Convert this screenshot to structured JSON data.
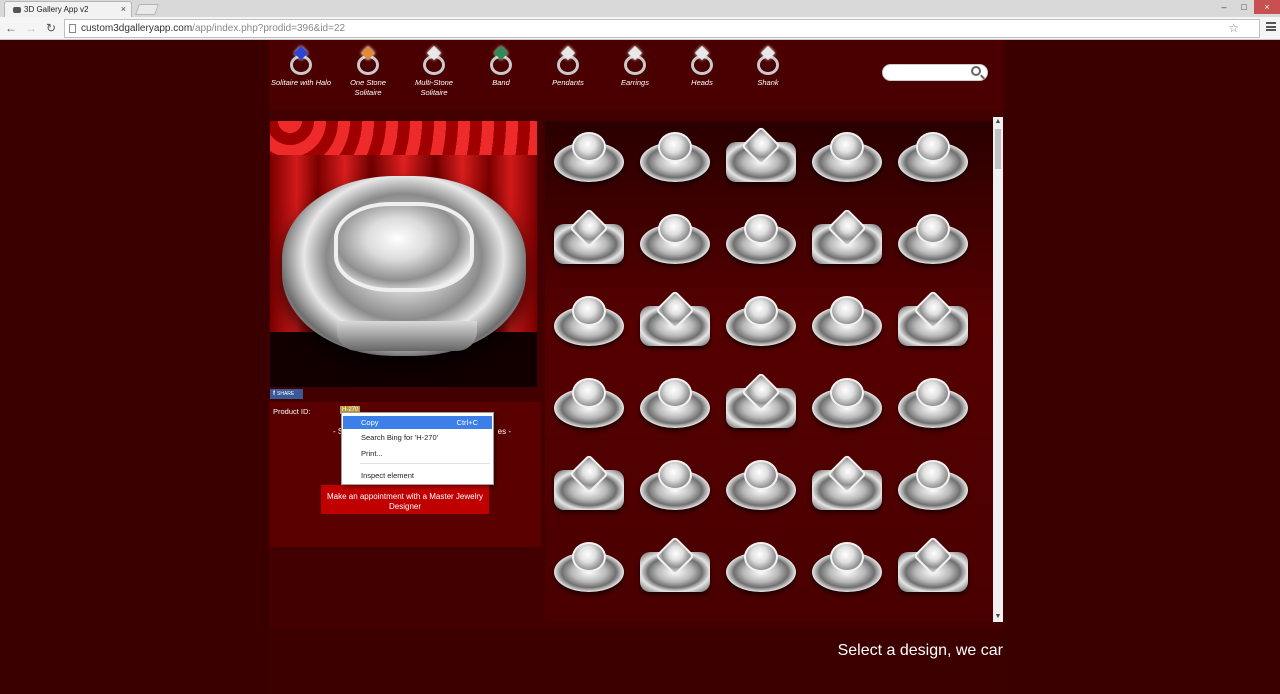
{
  "browser": {
    "tab_title": "3D Gallery App v2",
    "tab_close": "×",
    "url_host": "custom3dgalleryapp.com",
    "url_path": "/app/index.php?prodid=396&id=22",
    "window_controls": [
      "–",
      "□",
      "×"
    ],
    "nav": {
      "back": "←",
      "forward": "→",
      "reload": "↻"
    },
    "star": "☆"
  },
  "categories": [
    {
      "label": "Solitaire with Halo",
      "icon": "solitaire-halo-ring-icon",
      "gem_color": "#2a45d8"
    },
    {
      "label": "One Stone Solitaire",
      "icon": "one-stone-solitaire-ring-icon",
      "gem_color": "#e08a3c"
    },
    {
      "label": "Multi-Stone Solitaire",
      "icon": "multi-stone-ring-icon",
      "gem_color": "#e8e8e8"
    },
    {
      "label": "Band",
      "icon": "band-ring-icon",
      "gem_color": "#2e8b57"
    },
    {
      "label": "Pendants",
      "icon": "pendant-icon",
      "gem_color": "#e8e8e8"
    },
    {
      "label": "Earrings",
      "icon": "earrings-icon",
      "gem_color": "#e8e8e8"
    },
    {
      "label": "Heads",
      "icon": "head-setting-icon",
      "gem_color": "#e8e8e8"
    },
    {
      "label": "Shank",
      "icon": "shank-icon",
      "gem_color": "#e8e8e8"
    }
  ],
  "search": {
    "placeholder": ""
  },
  "preview": {
    "share_label": "SHARE",
    "share_icon": "facebook-icon"
  },
  "product": {
    "id_label": "Product ID:",
    "id_value": "H-270",
    "obscured_left": "- S",
    "obscured_right": "es -",
    "appointment_button": "Make an appointment with a Master Jewelry Designer"
  },
  "context_menu": {
    "items": [
      {
        "label": "Copy",
        "shortcut": "Ctrl+C",
        "selected": true
      },
      {
        "label": "Search Bing for 'H-270'",
        "shortcut": "",
        "selected": false
      },
      {
        "label": "Print...",
        "shortcut": "",
        "selected": false
      },
      {
        "label": "Inspect element",
        "shortcut": "",
        "selected": false
      }
    ]
  },
  "gallery": {
    "rows": 6,
    "cols": 5,
    "thumbnail_icon": "ring-head-thumbnail-icon"
  },
  "scrollbar": {
    "up": "▲",
    "down": "▼"
  },
  "footer": {
    "tagline": "Select a design, we car"
  },
  "colors": {
    "background": "#3a0000",
    "accent_red": "#c00000",
    "selection_blue": "#3d7fe8"
  }
}
